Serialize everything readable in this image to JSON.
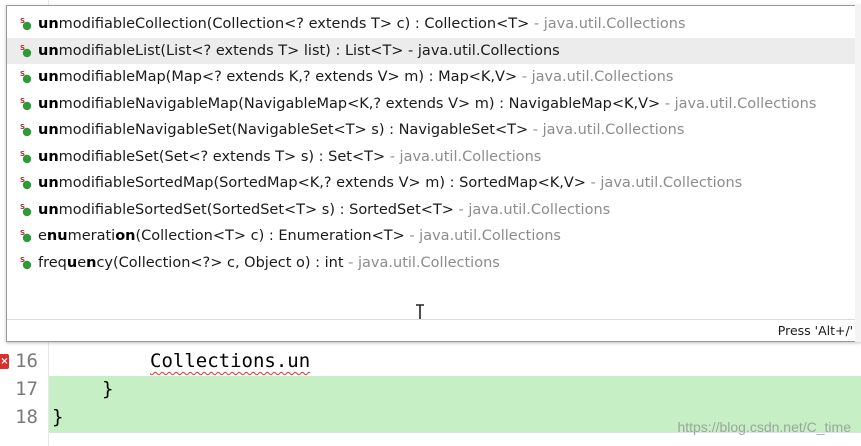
{
  "popup": {
    "proposals": [
      {
        "match": "un",
        "rest": "modifiableCollection(Collection<? extends T> c) : Collection<T>",
        "qualifier": " - java.util.Collections",
        "selected": false,
        "icon": "static-method-icon"
      },
      {
        "match": "un",
        "rest": "modifiableList(List<? extends T> list) : List<T> - java.util.Collections",
        "qualifier": "",
        "selected": true,
        "icon": "static-method-icon"
      },
      {
        "match": "un",
        "rest": "modifiableMap(Map<? extends K,? extends V> m) : Map<K,V>",
        "qualifier": " - java.util.Collections",
        "selected": false,
        "icon": "static-method-icon"
      },
      {
        "match": "un",
        "rest": "modifiableNavigableMap(NavigableMap<K,? extends V> m) : NavigableMap<K,V>",
        "qualifier": " - java.util.Collections",
        "selected": false,
        "icon": "static-method-icon"
      },
      {
        "match": "un",
        "rest": "modifiableNavigableSet(NavigableSet<T> s) : NavigableSet<T>",
        "qualifier": " - java.util.Collections",
        "selected": false,
        "icon": "static-method-icon"
      },
      {
        "match": "un",
        "rest": "modifiableSet(Set<? extends T> s) : Set<T>",
        "qualifier": " - java.util.Collections",
        "selected": false,
        "icon": "static-method-icon"
      },
      {
        "match": "un",
        "rest": "modifiableSortedMap(SortedMap<K,? extends V> m) : SortedMap<K,V>",
        "qualifier": " - java.util.Collections",
        "selected": false,
        "icon": "static-method-icon"
      },
      {
        "match": "un",
        "rest": "modifiableSortedSet(SortedSet<T> s) : SortedSet<T>",
        "qualifier": " - java.util.Collections",
        "selected": false,
        "icon": "static-method-icon"
      },
      {
        "segments": [
          [
            "e",
            false
          ],
          [
            "nu",
            true
          ],
          [
            "merati",
            false
          ],
          [
            "on",
            true
          ],
          [
            "(Collection<T> c) : Enumeration<T>",
            false
          ]
        ],
        "qualifier": " - java.util.Collections",
        "selected": false,
        "icon": "static-method-icon"
      },
      {
        "segments": [
          [
            "freq",
            false
          ],
          [
            "u",
            true
          ],
          [
            "e",
            false
          ],
          [
            "n",
            true
          ],
          [
            "cy(Collection<?> c, Object o) : int",
            false
          ]
        ],
        "qualifier": " - java.util.Collections",
        "selected": false,
        "icon": "static-method-icon"
      }
    ],
    "status_hint": "Press 'Alt+/' t"
  },
  "editor": {
    "lines": [
      {
        "number": "16",
        "prefix": "        ",
        "code": "Collections.un"
      },
      {
        "number": "17",
        "prefix": "    ",
        "code": "}"
      },
      {
        "number": "18",
        "prefix": "",
        "code": "}"
      }
    ],
    "error_marker": "×"
  },
  "watermark": "https://blog.csdn.net/C_time",
  "colors": {
    "icon_green": "#2e9a3a",
    "selection": "#ececec",
    "qualifier": "#8c8c8c",
    "line_highlight": "#c6efc6",
    "error": "#d9302c"
  }
}
